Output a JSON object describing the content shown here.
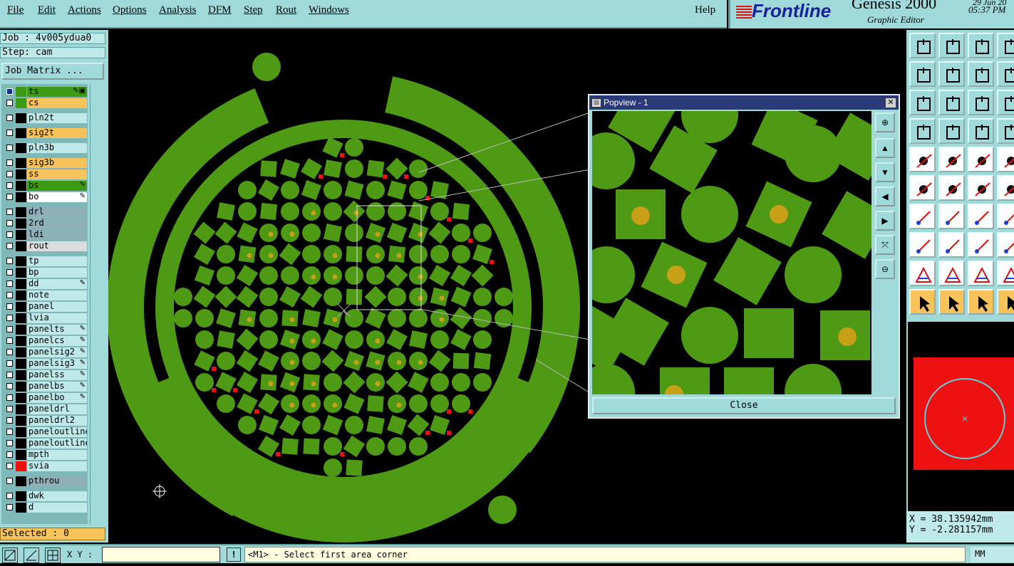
{
  "menu": [
    "File",
    "Edit",
    "Actions",
    "Options",
    "Analysis",
    "DFM",
    "Step",
    "Rout",
    "Windows"
  ],
  "help": "Help",
  "brand": {
    "logo": "Frontline",
    "product": "Genesis 2000",
    "subtitle": "Graphic Editor",
    "date": "29 Jun 20",
    "time": "05:37 PM"
  },
  "job": {
    "label": "Job : 4v005ydua0",
    "step": "Step: cam",
    "matrix_button": "Job Matrix ..."
  },
  "layers": [
    {
      "name": "ts",
      "color": "#3d9a14",
      "swatch": "#3d9a14",
      "active": true,
      "mark": "✎▣"
    },
    {
      "name": "cs",
      "color": "#f7c35a",
      "swatch": "#3d9a14"
    },
    {
      "name": "pln2t",
      "color": "#bfe9e9"
    },
    {
      "name": "sig2t",
      "color": "#f7c35a"
    },
    {
      "name": "pln3b",
      "color": "#bfe9e9"
    },
    {
      "name": "sig3b",
      "color": "#f7c35a"
    },
    {
      "name": "ss",
      "color": "#f7c35a"
    },
    {
      "name": "bs",
      "color": "#3d9a14",
      "mark": "✎"
    },
    {
      "name": "bo",
      "color": "#ffffff",
      "mark": "✎"
    },
    {
      "name": "drl",
      "color": "#8fb0b8"
    },
    {
      "name": "2rd",
      "color": "#8fb0b8"
    },
    {
      "name": "ldi",
      "color": "#8fb0b8"
    },
    {
      "name": "rout",
      "color": "#dcdcdc"
    },
    {
      "name": "tp",
      "color": "#bfe9e9"
    },
    {
      "name": "bp",
      "color": "#bfe9e9"
    },
    {
      "name": "dd",
      "color": "#bfe9e9",
      "mark": "✎"
    },
    {
      "name": "note",
      "color": "#bfe9e9"
    },
    {
      "name": "panel",
      "color": "#bfe9e9"
    },
    {
      "name": "lvia",
      "color": "#bfe9e9"
    },
    {
      "name": "panelts",
      "color": "#bfe9e9",
      "mark": "✎"
    },
    {
      "name": "panelcs",
      "color": "#bfe9e9",
      "mark": "✎"
    },
    {
      "name": "panelsig2",
      "color": "#bfe9e9",
      "mark": "✎"
    },
    {
      "name": "panelsig3",
      "color": "#bfe9e9",
      "mark": "✎"
    },
    {
      "name": "panelss",
      "color": "#bfe9e9",
      "mark": "✎"
    },
    {
      "name": "panelbs",
      "color": "#bfe9e9",
      "mark": "✎"
    },
    {
      "name": "panelbo",
      "color": "#bfe9e9",
      "mark": "✎"
    },
    {
      "name": "paneldrl",
      "color": "#bfe9e9"
    },
    {
      "name": "paneldrl2",
      "color": "#bfe9e9"
    },
    {
      "name": "paneloutline",
      "color": "#bfe9e9"
    },
    {
      "name": "paneloutline",
      "color": "#bfe9e9"
    },
    {
      "name": "mpth",
      "color": "#bfe9e9"
    },
    {
      "name": "svia",
      "color": "#bfe9e9",
      "swatch": "#ee1111"
    },
    {
      "name": "pthrou",
      "color": "#8fb0b8"
    },
    {
      "name": "dwk",
      "color": "#bfe9e9"
    },
    {
      "name": "d",
      "color": "#bfe9e9"
    }
  ],
  "selected": "Selected : 0",
  "popview": {
    "title": "Popview - 1",
    "close_button": "Close",
    "close_x": "✕",
    "sys": "☒"
  },
  "coords": {
    "x": "X = 38.135942mm",
    "y": "Y = -2.281157mm"
  },
  "status": {
    "xy_label": "X Y :",
    "xy_value": "",
    "bang": "!",
    "prompt": "<M1> - Select first area corner",
    "units": "MM"
  },
  "colors": {
    "pad": "#4f9a14",
    "hole": "#c8a018",
    "drill": "#ee1111",
    "panel": "#9fd9d9"
  }
}
